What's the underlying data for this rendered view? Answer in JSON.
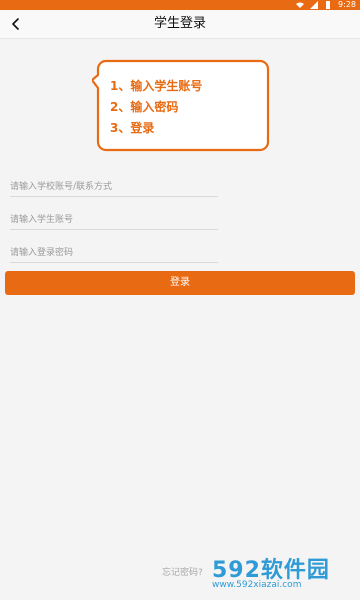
{
  "statusbar": {
    "time": "9:28",
    "wifi_icon": "wifi-icon",
    "signal_icon": "signal-icon",
    "battery_icon": "battery-icon"
  },
  "appbar": {
    "title": "学生登录",
    "back_icon": "chevron-left-icon"
  },
  "instructions": {
    "lines": [
      "1、输入学生账号",
      "2、输入密码",
      "3、登录"
    ],
    "accent_color": "#e86a12"
  },
  "form": {
    "school_placeholder": "请输入学校账号/联系方式",
    "student_placeholder": "请输入学生账号",
    "password_placeholder": "请输入登录密码",
    "login_label": "登录",
    "forgot_label": "忘记密码?"
  },
  "watermark": {
    "brand": "592软件园",
    "url": "www.592xiazai.com"
  }
}
